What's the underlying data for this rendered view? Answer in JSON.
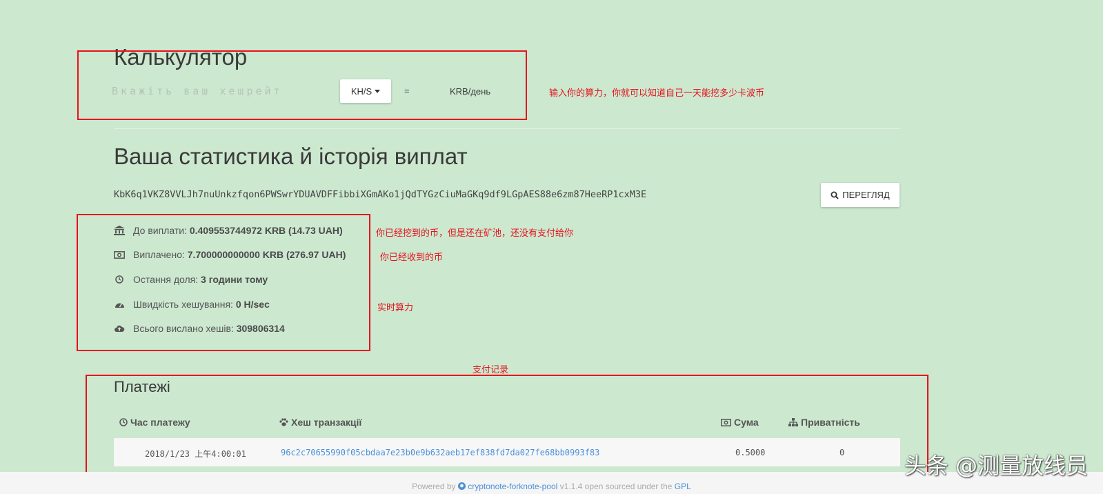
{
  "calculator": {
    "title": "Калькулятор",
    "hashrate_placeholder": "Вкажіть ваш хешрейт",
    "unit_label": "KH/S",
    "equals": "=",
    "result_unit": "KRB/день"
  },
  "stats": {
    "title": "Ваша статистика й історія виплат",
    "address": "KbK6q1VKZ8VVLJh7nuUnkzfqon6PWSwrYDUAVDFFibbiXGmAKo1jQdTYGzCiuMaGKq9df9LGpAES88e6zm87HeeRP1cxM3E",
    "lookup_label": "ПЕРЕГЛЯД",
    "rows": [
      {
        "label": "До виплати:",
        "value": "0.409553744972 KRB (14.73 UAH)",
        "icon": "bank-icon"
      },
      {
        "label": "Виплачено:",
        "value": "7.700000000000 KRB (276.97 UAH)",
        "icon": "money-icon"
      },
      {
        "label": "Остання доля:",
        "value": "3 години тому",
        "icon": "clock-icon"
      },
      {
        "label": "Швидкість хешування:",
        "value": "0 H/sec",
        "icon": "dashboard-icon"
      },
      {
        "label": "Всього вислано хешів:",
        "value": "309806314",
        "icon": "cloud-upload-icon"
      }
    ]
  },
  "payments": {
    "title": "Платежі",
    "columns": {
      "time": "Час платежу",
      "hash": "Хеш транзакції",
      "amount": "Сума",
      "privacy": "Приватність"
    },
    "rows": [
      {
        "time": "2018/1/23 上午4:00:01",
        "hash": "96c2c70655990f05cbdaa7e23b0e9b632aeb17ef838fd7da027fe68bb0993f83",
        "amount": "0.5000",
        "privacy": "0"
      }
    ]
  },
  "annotations": {
    "calculator_note": "输入你的算力，你就可以知道自己一天能挖多少卡波币",
    "pending_note": "你已经挖到的币，但是还在矿池，还没有支付给你",
    "paid_note": "你已经收到的币",
    "hashrate_note": "实时算力",
    "payments_note": "支付记录"
  },
  "footer": {
    "powered_by": "Powered by",
    "project": "cryptonote-forknote-pool",
    "suffix": "v1.1.4 open sourced under the",
    "license": "GPL"
  },
  "watermark": "头条 @测量放线员",
  "colors": {
    "background": "#cce8cf",
    "annotation_red": "#e8101c",
    "link_blue": "#4a90d9"
  }
}
